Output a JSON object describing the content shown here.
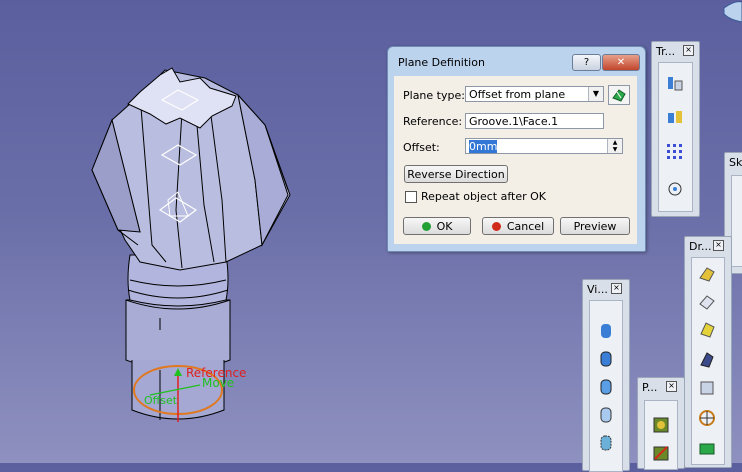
{
  "dialog": {
    "title": "Plane Definition",
    "help_label": "?",
    "close_label": "✕",
    "plane_type_label": "Plane type:",
    "plane_type_value": "Offset from plane",
    "reference_label": "Reference:",
    "reference_value": "Groove.1\\Face.1",
    "offset_label": "Offset:",
    "offset_value": "0mm",
    "reverse_label": "Reverse Direction",
    "repeat_label": "Repeat object after OK",
    "ok_label": "OK",
    "cancel_label": "Cancel",
    "preview_label": "Preview"
  },
  "viewport": {
    "manip_reference": "Reference",
    "manip_move": "Move",
    "manip_offset": "Offset"
  },
  "toolbars": {
    "tr_title": "Tr...",
    "dr_title": "Dr...",
    "vi_title": "Vi...",
    "p_title": "P...",
    "sk_title": "Sk"
  },
  "colors": {
    "background": "#6a6ea8",
    "part": "#b9bde0",
    "manipulator": "#e07820",
    "reference_text": "#e02020",
    "move_text": "#20c020"
  }
}
